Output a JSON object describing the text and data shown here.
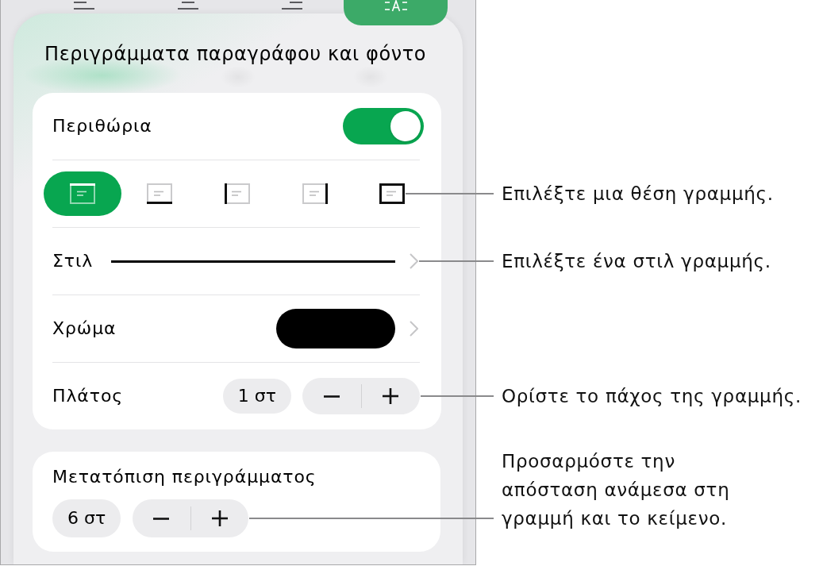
{
  "toolbar": {
    "items": [
      {
        "kind": "align-left",
        "selected": false
      },
      {
        "kind": "align-center",
        "selected": false
      },
      {
        "kind": "align-right",
        "selected": false
      },
      {
        "kind": "text-frame",
        "selected": true
      }
    ]
  },
  "panel": {
    "title": "Περιγράμματα παραγράφου και φόντο"
  },
  "borders": {
    "label": "Περιθώρια",
    "on": true
  },
  "border_positions": {
    "items": [
      {
        "kind": "top",
        "selected": true
      },
      {
        "kind": "bottom",
        "selected": false
      },
      {
        "kind": "left",
        "selected": false
      },
      {
        "kind": "right",
        "selected": false
      },
      {
        "kind": "box",
        "selected": false
      }
    ],
    "callout": "Επιλέξτε μια θέση γραμμής."
  },
  "style": {
    "label": "Στιλ",
    "kind": "solid",
    "callout": "Επιλέξτε ένα στιλ γραμμής."
  },
  "color": {
    "label": "Χρώμα",
    "color": "#000000"
  },
  "width": {
    "label": "Πλάτος",
    "value": "1 στ",
    "callout": "Ορίστε το πάχος της γραμμής."
  },
  "offset": {
    "label": "Μετατόπιση περιγράμματος",
    "value": "6 στ",
    "callout": "Προσαρμόστε την απόσταση ανάμεσα στη γραμμή και το κείμενο."
  }
}
